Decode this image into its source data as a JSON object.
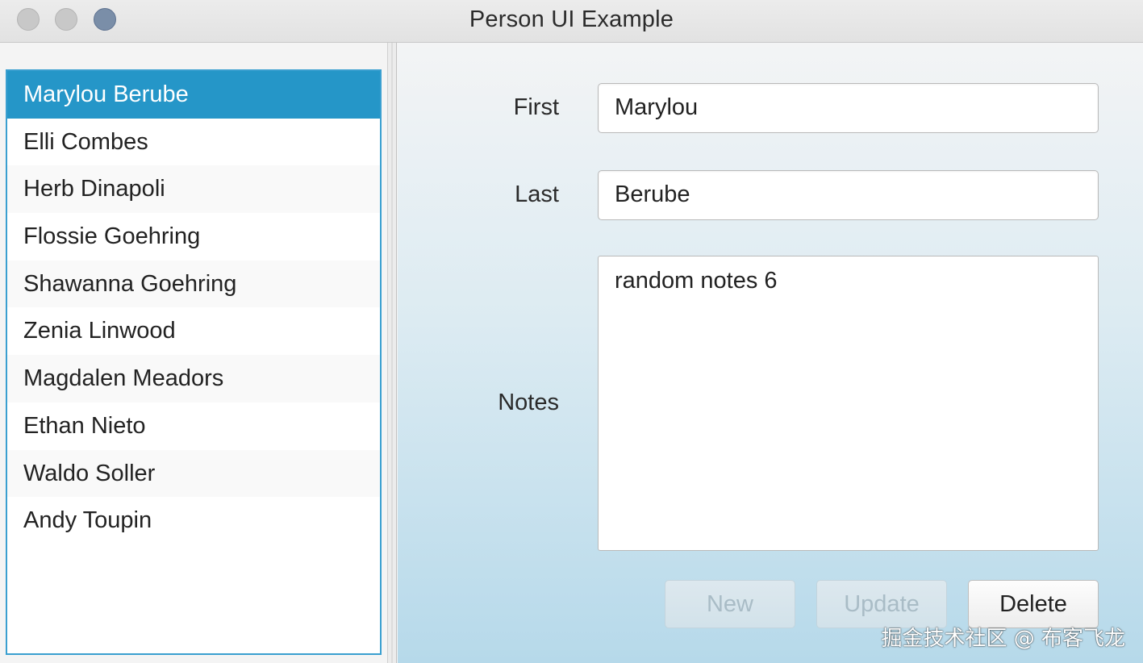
{
  "window": {
    "title": "Person UI Example"
  },
  "people_list": {
    "selected_index": 0,
    "items": [
      "Marylou Berube",
      "Elli Combes",
      "Herb Dinapoli",
      "Flossie Goehring",
      "Shawanna Goehring",
      "Zenia Linwood",
      "Magdalen Meadors",
      "Ethan Nieto",
      "Waldo Soller",
      "Andy Toupin"
    ]
  },
  "form": {
    "first_label": "First",
    "first_value": "Marylou",
    "last_label": "Last",
    "last_value": "Berube",
    "notes_label": "Notes",
    "notes_value": "random notes 6"
  },
  "buttons": {
    "new_label": "New",
    "update_label": "Update",
    "delete_label": "Delete",
    "new_enabled": false,
    "update_enabled": false,
    "delete_enabled": true
  },
  "watermark": "掘金技术社区 @ 布客飞龙",
  "colors": {
    "selection": "#2596c8",
    "list_border": "#3a9fd0"
  }
}
